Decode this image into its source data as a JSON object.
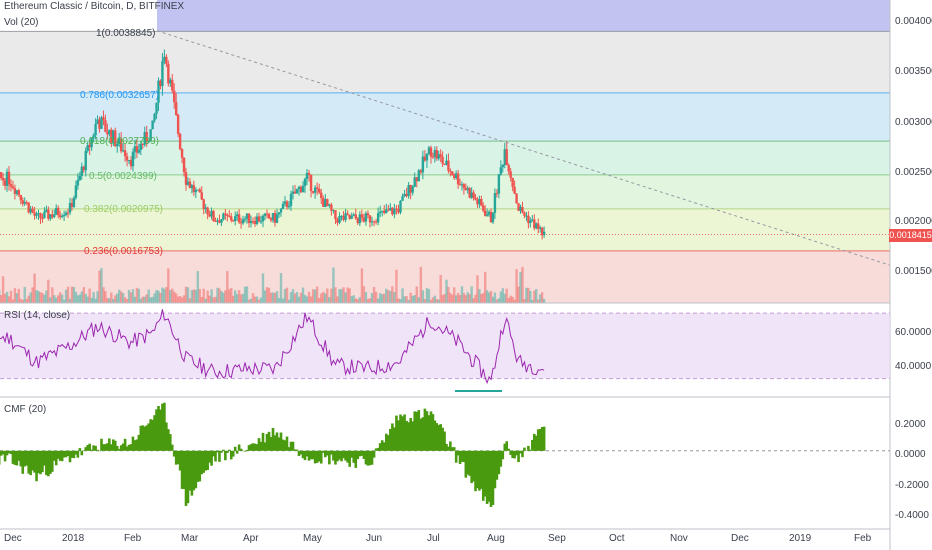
{
  "header": {
    "title": "Ethereum Classic / Bitcoin, D, BITFINEX",
    "volume_label": "Vol (20)"
  },
  "price_axis": {
    "ticks": [
      "0.0040000",
      "0.0035000",
      "0.0030000",
      "0.0025000",
      "0.0020000",
      "0.0015000"
    ],
    "last_price": "0.0018415"
  },
  "fib_levels": [
    {
      "label": "1(0.0038845)",
      "value": 0.0038845,
      "color": "#787b86"
    },
    {
      "label": "0.786(0.0032657)",
      "value": 0.0032657,
      "color": "#2196f3"
    },
    {
      "label": "0.618(0.0027799)",
      "value": 0.0027799,
      "color": "#4caf50"
    },
    {
      "label": "0.5(0.0024399)",
      "value": 0.0024399,
      "color": "#66bb6a"
    },
    {
      "label": "0.382(0.0020975)",
      "value": 0.0020975,
      "color": "#9ccc65"
    },
    {
      "label": "0.236(0.0016753)",
      "value": 0.0016753,
      "color": "#e53935"
    }
  ],
  "rsi": {
    "label": "RSI (14, close)",
    "ticks": [
      "60.0000",
      "40.0000"
    ]
  },
  "cmf": {
    "label": "CMF (20)",
    "ticks": [
      "0.2000",
      "0.0000",
      "-0.2000",
      "-0.4000"
    ]
  },
  "time_axis": {
    "ticks": [
      "Dec",
      "2018",
      "Feb",
      "Mar",
      "Apr",
      "May",
      "Jun",
      "Jul",
      "Aug",
      "Sep",
      "Oct",
      "Nov",
      "Dec",
      "2019",
      "Feb"
    ]
  },
  "colors": {
    "up": "#26a69a",
    "down": "#ef5350",
    "cmf": "#4a9a10",
    "rsi_line": "#9c27b0"
  },
  "chart_data": [
    {
      "type": "candlestick",
      "title": "Ethereum Classic / Bitcoin, D, BITFINEX",
      "ylim": [
        0.00115,
        0.0042
      ],
      "x": [
        "2017-12-01",
        "2017-12-15",
        "2018-01-01",
        "2018-01-15",
        "2018-02-01",
        "2018-02-12",
        "2018-02-18",
        "2018-03-01",
        "2018-03-15",
        "2018-04-01",
        "2018-04-15",
        "2018-05-01",
        "2018-05-15",
        "2018-06-01",
        "2018-06-15",
        "2018-07-01",
        "2018-07-15",
        "2018-08-01",
        "2018-08-08",
        "2018-08-15",
        "2018-08-28"
      ],
      "close": [
        0.0024,
        0.002,
        0.0021,
        0.003,
        0.0026,
        0.0029,
        0.0037,
        0.0024,
        0.002,
        0.002,
        0.002,
        0.0024,
        0.002,
        0.002,
        0.0021,
        0.0027,
        0.0024,
        0.002,
        0.0027,
        0.0021,
        0.00184
      ]
    },
    {
      "type": "line",
      "title": "RSI (14, close)",
      "ylim": [
        20,
        75
      ],
      "x": [
        "2017-12-01",
        "2017-12-15",
        "2018-01-01",
        "2018-01-15",
        "2018-02-01",
        "2018-02-12",
        "2018-02-18",
        "2018-03-01",
        "2018-03-15",
        "2018-04-01",
        "2018-04-15",
        "2018-05-01",
        "2018-05-15",
        "2018-06-01",
        "2018-06-15",
        "2018-07-01",
        "2018-07-15",
        "2018-08-01",
        "2018-08-08",
        "2018-08-15",
        "2018-08-28"
      ],
      "values": [
        55,
        40,
        50,
        62,
        52,
        58,
        70,
        42,
        34,
        36,
        36,
        68,
        38,
        36,
        40,
        66,
        52,
        28,
        68,
        40,
        36
      ]
    },
    {
      "type": "bar",
      "title": "CMF (20)",
      "ylim": [
        -0.45,
        0.3
      ],
      "x": [
        "2017-12-01",
        "2017-12-15",
        "2018-01-01",
        "2018-01-15",
        "2018-02-01",
        "2018-02-12",
        "2018-02-18",
        "2018-03-01",
        "2018-03-15",
        "2018-04-01",
        "2018-04-15",
        "2018-05-01",
        "2018-05-15",
        "2018-06-01",
        "2018-06-15",
        "2018-07-01",
        "2018-07-15",
        "2018-08-01",
        "2018-08-08",
        "2018-08-15",
        "2018-08-28"
      ],
      "values": [
        -0.05,
        -0.15,
        -0.04,
        0.03,
        0.05,
        0.2,
        0.25,
        -0.3,
        -0.05,
        0.02,
        0.12,
        -0.03,
        -0.05,
        -0.07,
        0.2,
        0.22,
        -0.05,
        -0.35,
        0.03,
        -0.05,
        0.15
      ]
    }
  ]
}
